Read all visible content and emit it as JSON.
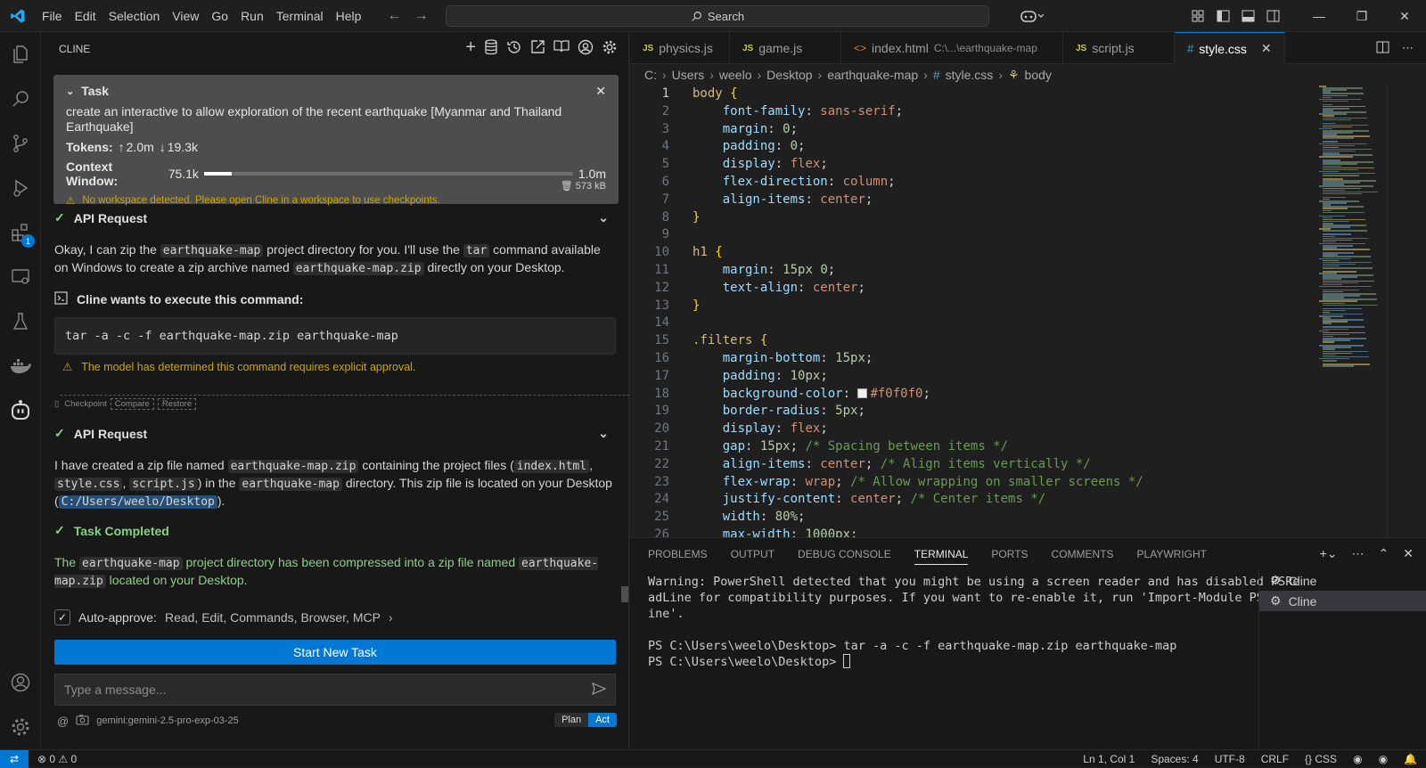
{
  "titlebar": {
    "menu": [
      "File",
      "Edit",
      "Selection",
      "View",
      "Go",
      "Run",
      "Terminal",
      "Help"
    ],
    "search_label": "Search"
  },
  "activitybar": {
    "extensions_badge": "1"
  },
  "cline": {
    "panel_title": "CLINE",
    "task": {
      "title": "Task",
      "text": "create an interactive to allow exploration of the recent earthquake  [Myanmar and Thailand Earthquake]",
      "tokens_label": "Tokens:",
      "tokens_up": "2.0m",
      "tokens_down": "19.3k",
      "size": "573 kB",
      "context_label": "Context Window:",
      "context_used": "75.1k",
      "context_max": "1.0m",
      "context_fraction": 0.075,
      "warning": "No workspace detected. Please open Cline in a workspace to use checkpoints."
    },
    "api_request_1": {
      "title": "API Request",
      "p1": "Okay, I can zip the ",
      "c1": "earthquake-map",
      "p2": " project directory for you. I'll use the ",
      "c2": "tar",
      "p3": " command available on Windows to create a zip archive named ",
      "c3": "earthquake-map.zip",
      "p4": " directly on your Desktop."
    },
    "command": {
      "title": "Cline wants to execute this command:",
      "text": "tar -a -c -f earthquake-map.zip earthquake-map",
      "approval": "The model has determined this command requires explicit approval."
    },
    "checkpoint": {
      "label": "Checkpoint",
      "compare": "Compare",
      "restore": "Restore"
    },
    "api_request_2": {
      "title": "API Request",
      "p1": "I have created a zip file named ",
      "c1": "earthquake-map.zip",
      "p2": " containing the project files (",
      "c2": "index.html",
      "p3": ", ",
      "c3": "style.css",
      "p4": ", ",
      "c4": "script.js",
      "p5": ") in the ",
      "c5": "earthquake-map",
      "p6": " directory. This zip file is located on your Desktop (",
      "c6": "C:/Users/weelo/Desktop",
      "p7": ")."
    },
    "completed": {
      "title": "Task Completed",
      "p1": "The ",
      "c1": "earthquake-map",
      "p2": " project directory has been compressed into a zip file named ",
      "c2": "earthquake-map.zip",
      "p3": " located on your Desktop."
    },
    "auto_approve_label": "Auto-approve:",
    "auto_approve_items": "Read, Edit, Commands, Browser, MCP",
    "start_new_task": "Start New Task",
    "message_placeholder": "Type a message...",
    "model": "gemini:gemini-2.5-pro-exp-03-25",
    "plan": "Plan",
    "act": "Act"
  },
  "editor": {
    "tabs": [
      {
        "label": "physics.js",
        "type": "JS"
      },
      {
        "label": "game.js",
        "type": "JS"
      },
      {
        "label": "index.html",
        "path": "C:\\...\\earthquake-map",
        "type": "<>"
      },
      {
        "label": "script.js",
        "type": "JS"
      },
      {
        "label": "style.css",
        "type": "#"
      }
    ],
    "breadcrumb": [
      "C:",
      "Users",
      "weelo",
      "Desktop",
      "earthquake-map",
      "style.css",
      "body"
    ],
    "lines": [
      "1",
      "2",
      "3",
      "4",
      "5",
      "6",
      "7",
      "8",
      "9",
      "10",
      "11",
      "12",
      "13",
      "14",
      "15",
      "16",
      "17",
      "18",
      "19",
      "20",
      "21",
      "22",
      "23",
      "24",
      "25",
      "26"
    ]
  },
  "panel": {
    "tabs": [
      "PROBLEMS",
      "OUTPUT",
      "DEBUG CONSOLE",
      "TERMINAL",
      "PORTS",
      "COMMENTS",
      "PLAYWRIGHT"
    ],
    "active_tab": "TERMINAL",
    "terminal_lines": [
      "Warning: PowerShell detected that you might be using a screen reader and has disabled PSRe",
      "adLine for compatibility purposes. If you want to re-enable it, run 'Import-Module PSReadL",
      "ine'.",
      "",
      "PS C:\\Users\\weelo\\Desktop> tar -a -c -f earthquake-map.zip earthquake-map",
      "PS C:\\Users\\weelo\\Desktop> "
    ],
    "terminals": [
      "Cline",
      "Cline"
    ]
  },
  "statusbar": {
    "errors": "0",
    "warnings": "0",
    "position": "Ln 1, Col 1",
    "spaces": "Spaces: 4",
    "encoding": "UTF-8",
    "eol": "CRLF",
    "language": "CSS",
    "language_prefix": "{}"
  },
  "colors": {
    "accent": "#0078d4",
    "success": "#89d185",
    "warning": "#cca700"
  }
}
